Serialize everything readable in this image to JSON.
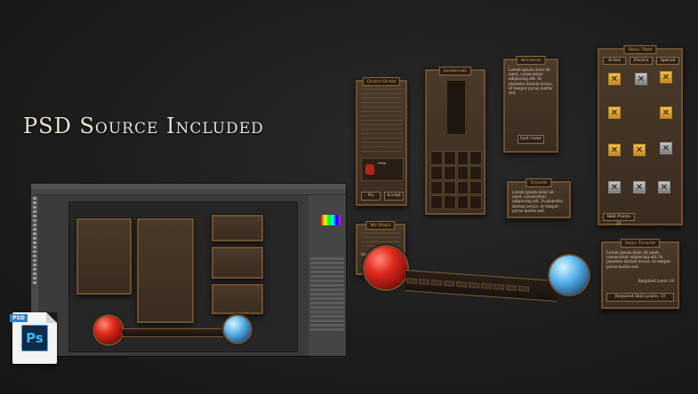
{
  "headline": "PSD Source Included",
  "psd_badge": {
    "tag": "PSD",
    "logo": "Ps"
  },
  "panels": {
    "quest_guide": {
      "title": "Quest Guide",
      "btn_no": "No",
      "btn_accept": "Accept",
      "item_label": "Item"
    },
    "inventory": {
      "title": "Inventory"
    },
    "dialogue": {
      "title": "Settings",
      "text": "Lorem ipsum dolor sit amet, consectetur adipiscing elit. In pharetra dictum lectus, et tempor purus mattis sed.",
      "button": "Quit Game"
    },
    "tooltip": {
      "title": "Tooltip",
      "text": "Lorem ipsum dolor sit amet, consectetur adipiscing elit. In pharetra dictum lectus, et tempor purus mattis sed."
    },
    "stats": {
      "title": "My Stats",
      "level": "Required Level: 11"
    },
    "skill_tree": {
      "title": "Skill Tree",
      "tabs": [
        "Active",
        "Passive",
        "Special"
      ],
      "points": "Skill Points: 21"
    },
    "skill_tooltip": {
      "title": "Skill Tooltip",
      "text": "Lorem ipsum dolor sit amet, consectetur adipiscing elit. In pharetra dictum lectus, et tempor purus mattis sed.",
      "level": "Required Level: 18",
      "points": "Required Skill points: 10"
    }
  }
}
